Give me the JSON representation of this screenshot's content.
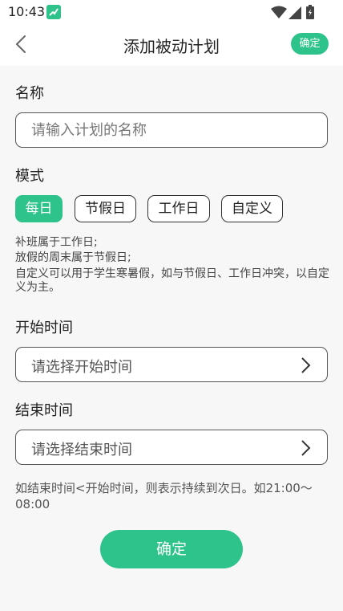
{
  "status_bar": {
    "time": "10:43",
    "icons": [
      "app-notification-icon",
      "wifi-icon",
      "signal-icon",
      "battery-icon"
    ]
  },
  "header": {
    "back_icon": "chevron-left-icon",
    "title": "添加被动计划",
    "confirm_label": "确定"
  },
  "name_section": {
    "label": "名称",
    "placeholder": "请输入计划的名称",
    "value": ""
  },
  "mode_section": {
    "label": "模式",
    "options": [
      {
        "label": "每日",
        "selected": true
      },
      {
        "label": "节假日",
        "selected": false
      },
      {
        "label": "工作日",
        "selected": false
      },
      {
        "label": "自定义",
        "selected": false
      }
    ],
    "notes": [
      "补班属于工作日;",
      "放假的周末属于节假日;",
      "自定义可以用于学生寒暑假，如与节假日、工作日冲突，以自定义为主。"
    ]
  },
  "start_section": {
    "label": "开始时间",
    "placeholder": "请选择开始时间"
  },
  "end_section": {
    "label": "结束时间",
    "placeholder": "请选择结束时间"
  },
  "end_note": "如结束时间<开始时间，则表示持续到次日。如21:00～08:00",
  "confirm_button": "确定",
  "colors": {
    "accent": "#2ec38a",
    "background": "#f7f7f7",
    "header_bg": "#ffffff"
  }
}
